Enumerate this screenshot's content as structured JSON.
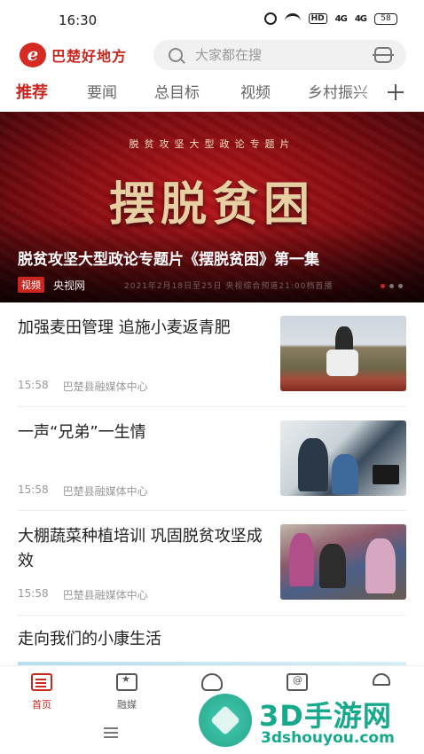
{
  "status_bar": {
    "time": "16:30",
    "hd_label": "HD",
    "signal_1": "4G",
    "signal_2": "4G",
    "battery": "58"
  },
  "header": {
    "app_name": "巴楚好地方",
    "logo_letter": "e",
    "search_placeholder": "大家都在搜",
    "brand_color": "#c8261e"
  },
  "tabs": [
    {
      "label": "推荐",
      "active": true
    },
    {
      "label": "要闻",
      "active": false
    },
    {
      "label": "总目标",
      "active": false
    },
    {
      "label": "视频",
      "active": false
    },
    {
      "label": "乡村振兴",
      "active": false
    }
  ],
  "banner": {
    "subtitle": "脱贫攻坚大型政论专题片",
    "big_title": "摆脱贫困",
    "headline": "脱贫攻坚大型政论专题片《摆脱贫困》第一集",
    "tag": "视频",
    "source": "央视网",
    "air_info": "2021年2月18日至25日  央视综合频道21:00档首播",
    "slide_count": 3,
    "active_slide": 1
  },
  "news": [
    {
      "title": "加强麦田管理 追施小麦返青肥",
      "time": "15:58",
      "source": "巴楚县融媒体中心"
    },
    {
      "title": "一声“兄弟”一生情",
      "time": "15:58",
      "source": "巴楚县融媒体中心"
    },
    {
      "title": "大棚蔬菜种植培训 巩固脱贫攻坚成效",
      "time": "15:58",
      "source": "巴楚县融媒体中心"
    },
    {
      "title": "走向我们的小康生活"
    }
  ],
  "bottom_nav": [
    {
      "label": "首页",
      "icon": "home-icon",
      "active": true
    },
    {
      "label": "融媒",
      "icon": "media-icon",
      "active": false
    },
    {
      "label": "",
      "icon": "cloud-icon",
      "active": false
    },
    {
      "label": "",
      "icon": "at-icon",
      "active": false
    },
    {
      "label": "",
      "icon": "user-icon",
      "active": false
    }
  ],
  "watermark": {
    "text": "3D手游网",
    "url": "3dshouyou.com",
    "color": "#16a98b"
  }
}
